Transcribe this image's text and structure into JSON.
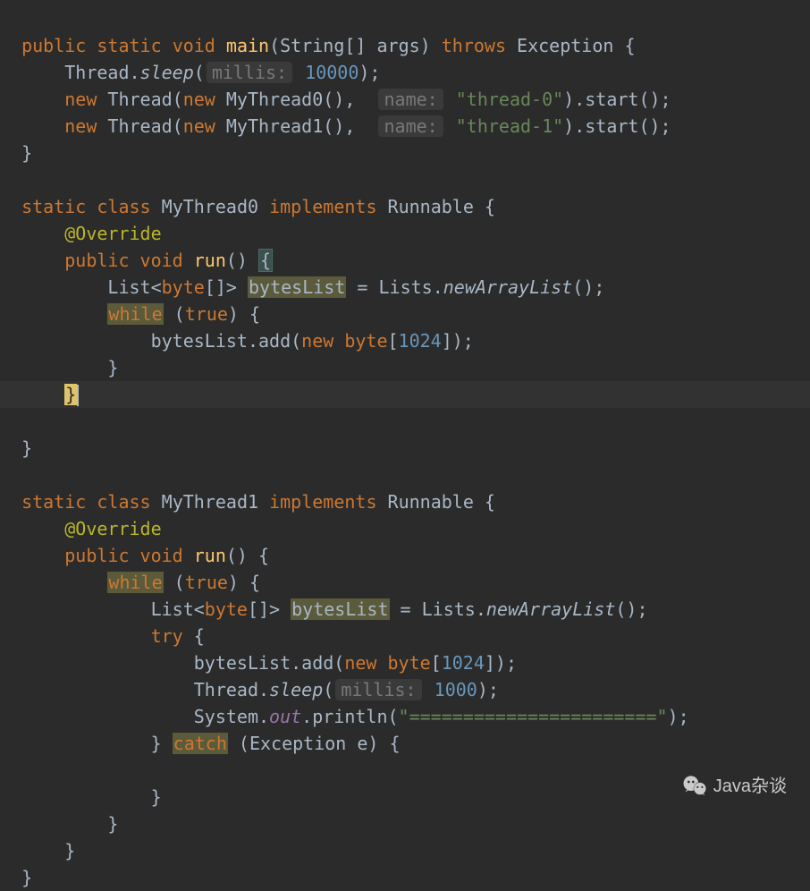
{
  "code": {
    "l1": {
      "kw_public": "public",
      "kw_static": "static",
      "kw_void": "void",
      "name": "main",
      "params_open": "(String[] args)",
      "kw_throws": "throws",
      "exc": "Exception",
      "brace": "{"
    },
    "l2": {
      "thread": "Thread.",
      "sleep": "sleep",
      "open": "(",
      "hint": "millis:",
      "num": "10000",
      "close": ");"
    },
    "l3": {
      "kw_new1": "new",
      "thread": "Thread(",
      "kw_new2": "new",
      "my": "MyThread0(),",
      "hint": "name:",
      "str": "\"thread-0\"",
      "tail": ").start();"
    },
    "l4": {
      "kw_new1": "new",
      "thread": "Thread(",
      "kw_new2": "new",
      "my": "MyThread1(),",
      "hint": "name:",
      "str": "\"thread-1\"",
      "tail": ").start();"
    },
    "l5": {
      "brace": "}"
    },
    "l7": {
      "kw_static": "static",
      "kw_class": "class",
      "name": "MyThread0",
      "kw_impl": "implements",
      "iface": "Runnable",
      "brace": "{"
    },
    "l8": {
      "ann": "@Override"
    },
    "l9": {
      "kw_public": "public",
      "kw_void": "void",
      "name": "run",
      "params": "()",
      "brace": "{"
    },
    "l10": {
      "list": "List<",
      "kw_byte": "byte",
      "arr": "[]> ",
      "var": "bytesList",
      "eq": " = Lists.",
      "call": "newArrayList",
      "end": "();"
    },
    "l11": {
      "kw_while": "while",
      "cond": " (",
      "kw_true": "true",
      "close": ") {"
    },
    "l12": {
      "var": "bytesList.add(",
      "kw_new": "new",
      "sp": " ",
      "kw_byte": "byte",
      "open": "[",
      "num": "1024",
      "close": "]);"
    },
    "l13": {
      "brace": "}"
    },
    "l14": {
      "brace": "}"
    },
    "l15": {
      "brace": "}"
    },
    "l17": {
      "kw_static": "static",
      "kw_class": "class",
      "name": "MyThread1",
      "kw_impl": "implements",
      "iface": "Runnable",
      "brace": "{"
    },
    "l18": {
      "ann": "@Override"
    },
    "l19": {
      "kw_public": "public",
      "kw_void": "void",
      "name": "run",
      "params": "() {"
    },
    "l20": {
      "kw_while": "while",
      "cond": " (",
      "kw_true": "true",
      "close": ") {"
    },
    "l21": {
      "list": "List<",
      "kw_byte": "byte",
      "arr": "[]> ",
      "var": "bytesList",
      "eq": " = Lists.",
      "call": "newArrayList",
      "end": "();"
    },
    "l22": {
      "kw_try": "try",
      "brace": " {"
    },
    "l23": {
      "var": "bytesList.add(",
      "kw_new": "new",
      "sp": " ",
      "kw_byte": "byte",
      "open": "[",
      "num": "1024",
      "close": "]);"
    },
    "l24": {
      "thread": "Thread.",
      "sleep": "sleep",
      "open": "(",
      "hint": "millis:",
      "num": "1000",
      "close": ");"
    },
    "l25": {
      "sys": "System.",
      "out": "out",
      "print": ".println(",
      "str": "\"=======================\"",
      "close": ");"
    },
    "l26": {
      "close": "} ",
      "kw_catch": "catch",
      "rest": " (Exception e) {"
    },
    "l28": {
      "brace": "}"
    },
    "l29": {
      "brace": "}"
    },
    "l30": {
      "brace": "}"
    },
    "l31": {
      "brace": "}"
    }
  },
  "watermark": {
    "text": "Java杂谈"
  }
}
